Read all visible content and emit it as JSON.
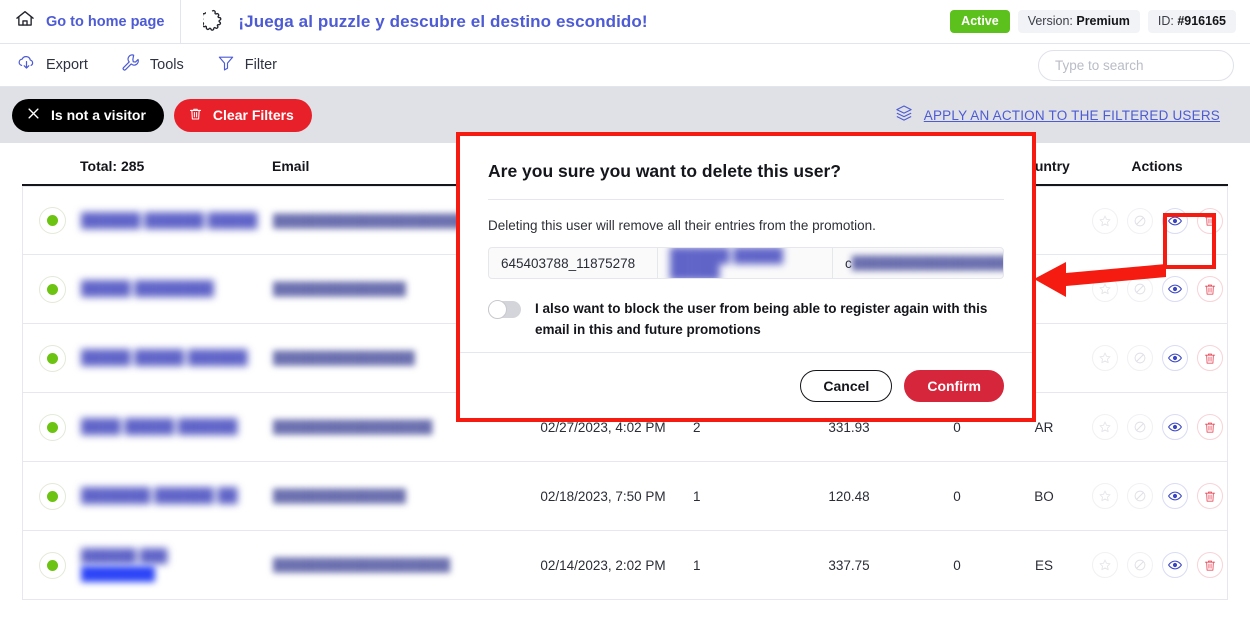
{
  "topbar": {
    "home_label": "Go to home page",
    "home_icon": "home-icon",
    "promo_icon": "puzzle-piece-icon",
    "promo_title": "¡Juega al puzzle y descubre el destino escondido!",
    "status_badge": "Active",
    "version_prefix": "Version:",
    "version_value": "Premium",
    "id_prefix": "ID:",
    "id_value": "#916165",
    "active_color": "#5cc11c",
    "brand_color": "#4d5bd4"
  },
  "actionbar": {
    "items": [
      {
        "label": "Export",
        "icon": "cloud-download-icon"
      },
      {
        "label": "Tools",
        "icon": "wrench-icon"
      },
      {
        "label": "Filter",
        "icon": "funnel-icon"
      }
    ],
    "search_placeholder": "Type to search"
  },
  "filterstrip": {
    "active_filter": {
      "label": "Is not a visitor",
      "icon": "close-icon"
    },
    "clear_filters": {
      "label": "Clear Filters",
      "icon": "trash-icon"
    },
    "apply_action": {
      "label": "APPLY AN ACTION TO THE FILTERED USERS",
      "icon": "layers-icon"
    }
  },
  "table": {
    "headers": {
      "total": "Total: 285",
      "email": "Email",
      "country": "Country",
      "actions": "Actions"
    },
    "row_actions": [
      {
        "name": "favorite-icon",
        "title": "star"
      },
      {
        "name": "block-icon",
        "title": "block"
      },
      {
        "name": "view-icon",
        "title": "eye"
      },
      {
        "name": "delete-icon",
        "title": "trash"
      }
    ],
    "rows": [
      {
        "status": "active",
        "name": "██████ ██████ █████",
        "email": "██████████████████████",
        "date": "",
        "entries": "",
        "points": "",
        "extra": "",
        "country": "",
        "redacted": true
      },
      {
        "status": "active",
        "name": "█████ ████████",
        "email": "███████████████",
        "date": "",
        "entries": "",
        "points": "",
        "extra": "",
        "country": "",
        "redacted": true
      },
      {
        "status": "active",
        "name": "█████ █████ ██████",
        "email": "████████████████",
        "date": "",
        "entries": "",
        "points": "",
        "extra": "",
        "country": "",
        "redacted": true
      },
      {
        "status": "active",
        "name": "████ █████ ██████",
        "email": "██████████████████",
        "date": "02/27/2023, 4:02 PM",
        "entries": "2",
        "points": "331.93",
        "extra": "0",
        "country": "AR",
        "redacted": true
      },
      {
        "status": "active",
        "name": "███████ ██████ ██",
        "email": "███████████████",
        "date": "02/18/2023, 7:50 PM",
        "entries": "1",
        "points": "120.48",
        "extra": "0",
        "country": "BO",
        "redacted": true
      },
      {
        "status": "active",
        "name": "██████ ███",
        "email": "████████████████████",
        "date": "02/14/2023, 2:02 PM",
        "entries": "1",
        "points": "337.75",
        "extra": "0",
        "country": "ES",
        "redacted": true,
        "selected_text": "████████"
      }
    ]
  },
  "modal": {
    "title": "Are you sure you want to delete this user?",
    "subtitle": "Deleting this user will remove all their entries from the promotion.",
    "user_id": "645403788_11875278",
    "user_name": "██████ █████ █████",
    "user_email_prefix": "c",
    "user_email": "██████████████████",
    "user_email_suffix": ".",
    "block_toggle_label": "I also want to block the user from being able to register again with this email in this and future promotions",
    "block_toggle_state": "off",
    "cancel_label": "Cancel",
    "confirm_label": "Confirm",
    "confirm_color": "#d6263c",
    "highlight_color": "#f51b10"
  },
  "annotations": {
    "highlight_box_target": "delete-icon-row-1",
    "arrow_direction": "left",
    "arrow_color": "#f51b10"
  }
}
